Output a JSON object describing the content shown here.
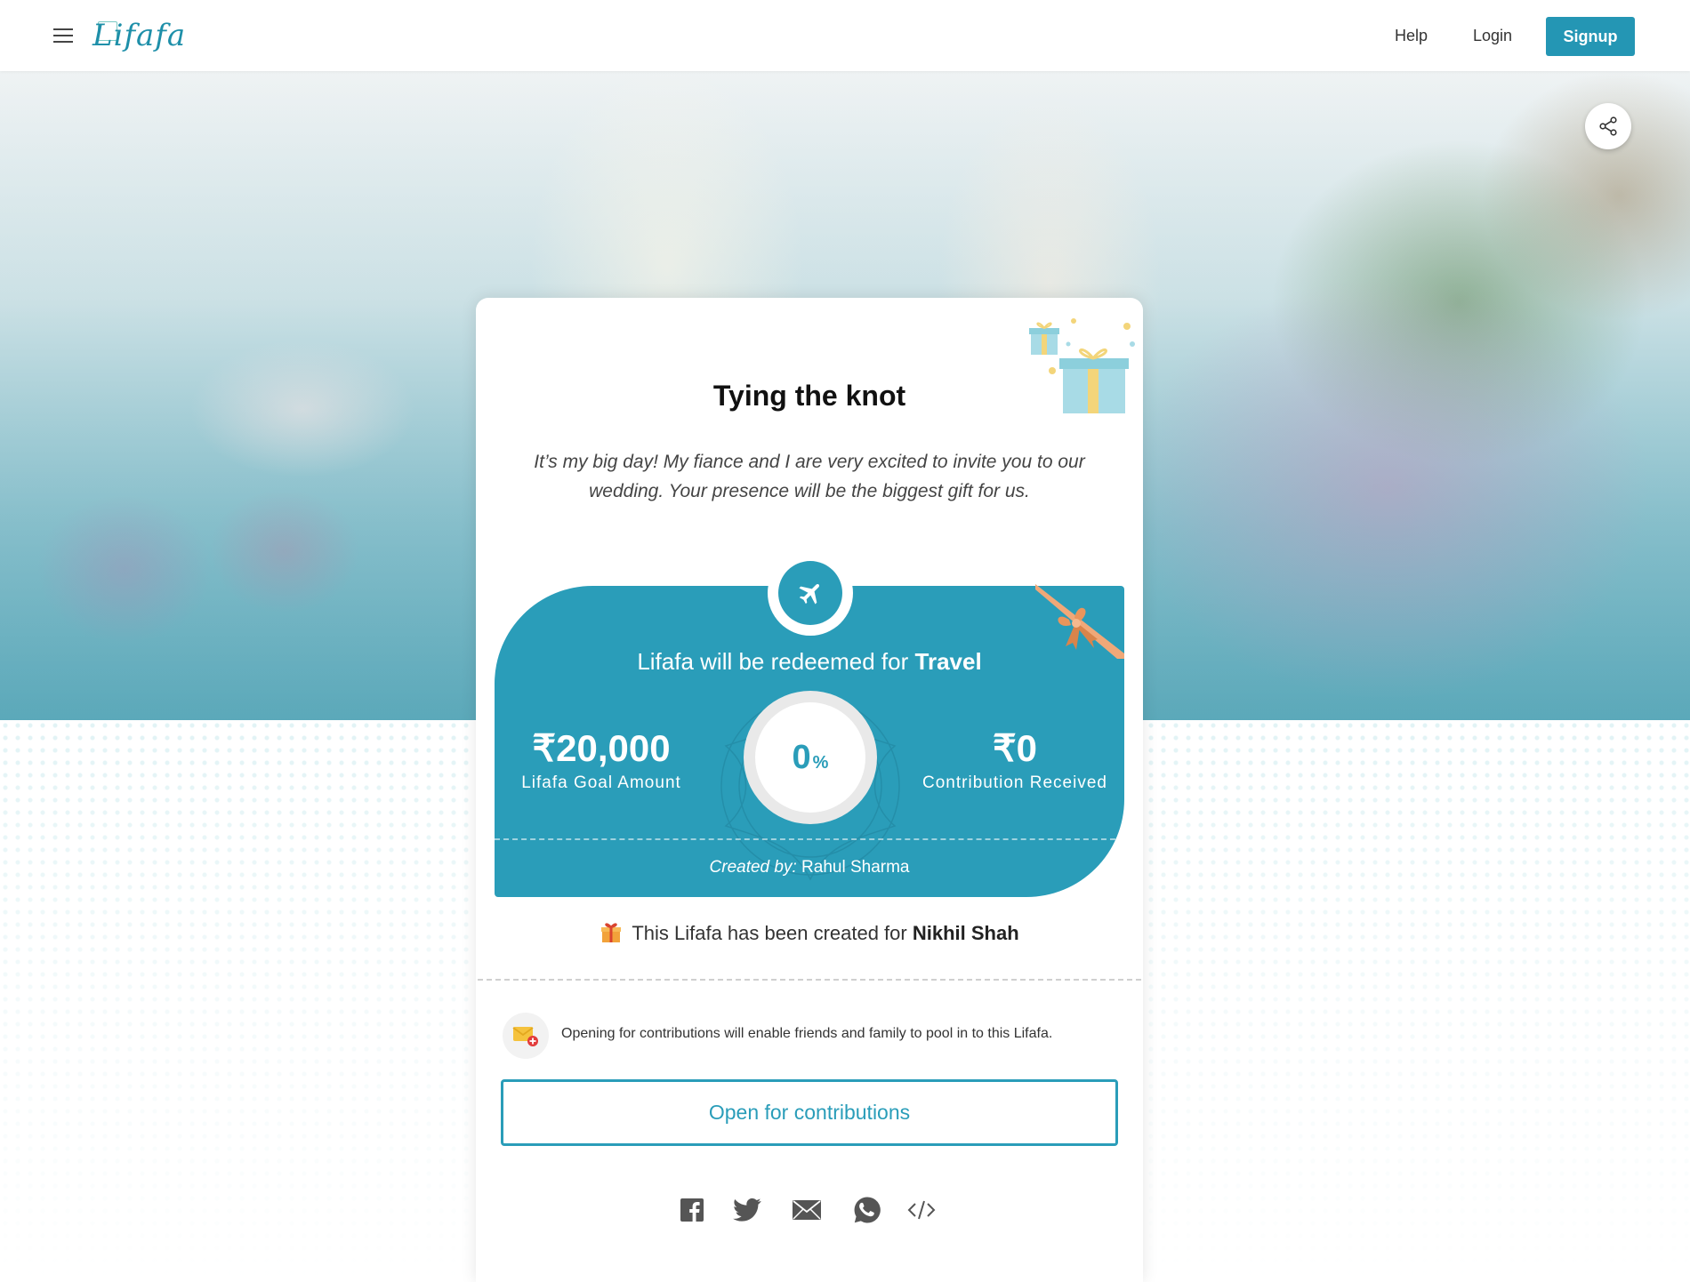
{
  "header": {
    "logo_text": "Lifafa",
    "nav": {
      "help": "Help",
      "login": "Login",
      "signup": "Signup"
    }
  },
  "card": {
    "title": "Tying the knot",
    "description": "It’s my big day! My fiance and I are very excited to invite you to our wedding. Your presence will be the biggest gift for us.",
    "redeem_prefix": "Lifafa will be redeemed for",
    "redeem_category": "Travel",
    "goal_amount": "₹20,000",
    "goal_label": "Lifafa Goal Amount",
    "progress_value": "0",
    "progress_unit": "%",
    "progress_fraction": 0,
    "received_amount": "₹0",
    "received_label": "Contribution Received",
    "created_by_label": "Created by:",
    "created_by_name": "Rahul Sharma",
    "created_for_prefix": "This Lifafa has been created for",
    "created_for_name": "Nikhil Shah",
    "contrib_info": "Opening for contributions will enable friends and family to pool in to this Lifafa.",
    "open_button": "Open for contributions"
  },
  "icons": {
    "menu": "hamburger-icon",
    "share": "share-icon",
    "category": "airplane-icon",
    "social": [
      "facebook-icon",
      "twitter-icon",
      "email-icon",
      "whatsapp-icon",
      "embed-code-icon"
    ]
  },
  "colors": {
    "accent": "#2a9db9",
    "signup_bg": "#2496b4"
  }
}
